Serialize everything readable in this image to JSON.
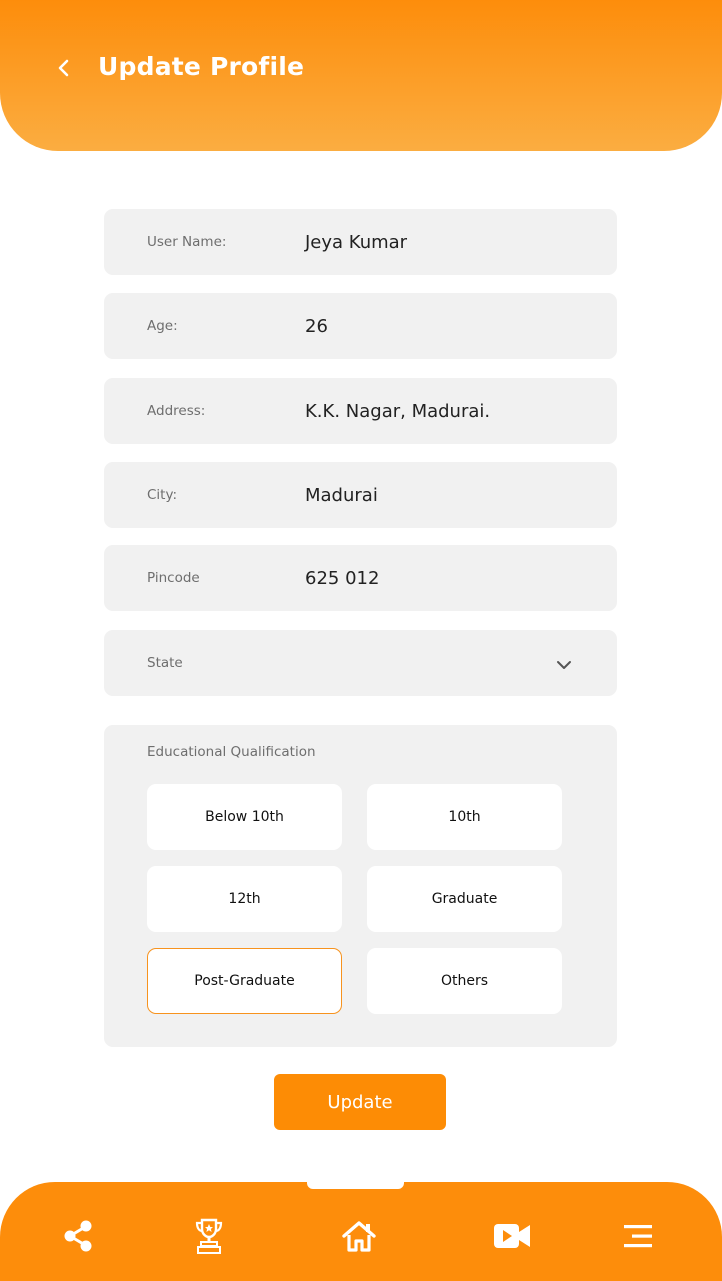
{
  "header": {
    "title": "Update Profile",
    "back_icon": "chevron-left-icon"
  },
  "form": {
    "user_name": {
      "label": "User Name:",
      "value": "Jeya Kumar"
    },
    "age": {
      "label": "Age:",
      "value": "26"
    },
    "address": {
      "label": "Address:",
      "value": "K.K. Nagar, Madurai."
    },
    "city": {
      "label": "City:",
      "value": "Madurai"
    },
    "pincode": {
      "label": "Pincode",
      "value": "625 012"
    },
    "state": {
      "label": "State",
      "value": "",
      "icon": "chevron-down-icon"
    }
  },
  "education": {
    "label": "Educational Qualification",
    "options": [
      "Below 10th",
      "10th",
      "12th",
      "Graduate",
      "Post-Graduate",
      "Others"
    ],
    "selected": "Post-Graduate"
  },
  "update_button": {
    "label": "Update"
  },
  "bottom_nav": {
    "items": [
      "share-icon",
      "trophy-icon",
      "home-icon",
      "video-icon",
      "menu-icon"
    ]
  },
  "colors": {
    "accent": "#fd8c05",
    "header_top": "#fd8d0b",
    "header_bottom": "#fbad41",
    "field_bg": "#f1f1f1",
    "selected_border": "#f7931e"
  }
}
